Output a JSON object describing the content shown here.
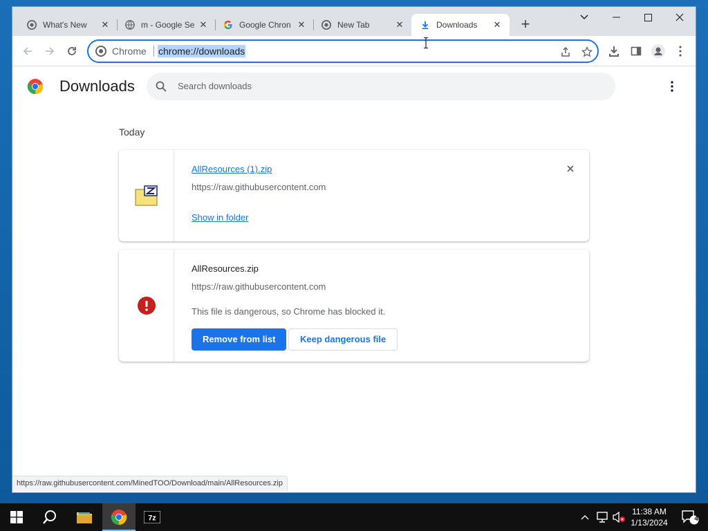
{
  "browser": {
    "tabs": [
      {
        "title": "What's New",
        "icon": "chrome-icon"
      },
      {
        "title": "m - Google Se",
        "icon": "globe-icon"
      },
      {
        "title": "Google Chron",
        "icon": "google-g-icon"
      },
      {
        "title": "New Tab",
        "icon": "chrome-icon"
      },
      {
        "title": "Downloads",
        "icon": "download-icon",
        "active": true
      }
    ],
    "omnibox": {
      "chip_label": "Chrome",
      "url": "chrome://downloads"
    }
  },
  "page": {
    "title": "Downloads",
    "search_placeholder": "Search downloads",
    "section_label": "Today",
    "downloads": [
      {
        "filename": "AllResources (1).zip",
        "source": "https://raw.githubusercontent.com",
        "action_link": "Show in folder",
        "icon": "zip-archive-icon"
      },
      {
        "filename": "AllResources.zip",
        "source": "https://raw.githubusercontent.com",
        "warning": "This file is dangerous, so Chrome has blocked it.",
        "primary_button": "Remove from list",
        "secondary_button": "Keep dangerous file",
        "icon": "danger-icon"
      }
    ],
    "status_url": "https://raw.githubusercontent.com/MinedTOO/Download/main/AllResources.zip"
  },
  "taskbar": {
    "clock_time": "11:38 AM",
    "clock_date": "1/13/2024",
    "notification_count": "4",
    "pinned": [
      "start-icon",
      "search-icon",
      "file-explorer-icon",
      "chrome-icon",
      "7zip-icon"
    ]
  },
  "colors": {
    "accent": "#1a73e8",
    "danger": "#c5221f",
    "tabstrip": "#dee1e6"
  }
}
